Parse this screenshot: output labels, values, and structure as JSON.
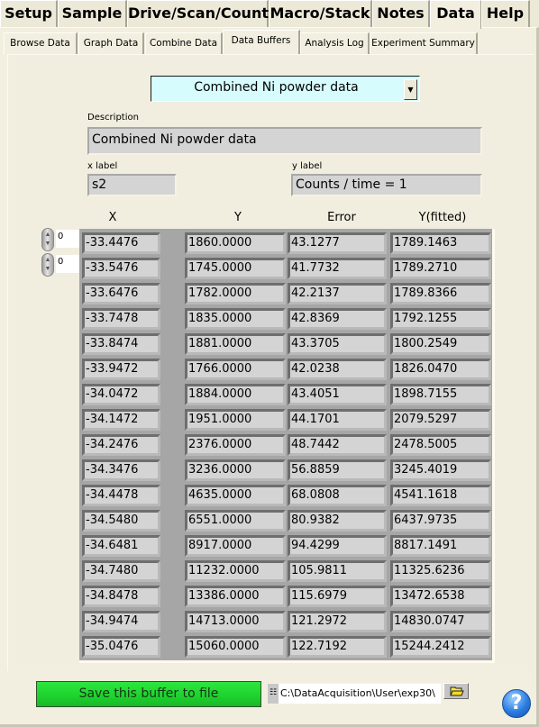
{
  "top_tabs": [
    {
      "label": "Setup",
      "active": false
    },
    {
      "label": "Sample",
      "active": false
    },
    {
      "label": "Drive/Scan/Count",
      "active": false
    },
    {
      "label": "Macro/Stack",
      "active": false
    },
    {
      "label": "Notes",
      "active": false
    },
    {
      "label": "Data",
      "active": true
    },
    {
      "label": "Help",
      "active": false
    }
  ],
  "sub_tabs": [
    {
      "label": "Browse Data",
      "active": false
    },
    {
      "label": "Graph Data",
      "active": false
    },
    {
      "label": "Combine Data",
      "active": false
    },
    {
      "label": "Data Buffers",
      "active": true
    },
    {
      "label": "Analysis Log",
      "active": false
    },
    {
      "label": "Experiment Summary",
      "active": false
    }
  ],
  "buffer_selector": {
    "value": "Combined Ni powder data",
    "arrow_icon": "dropdown-arrow"
  },
  "description": {
    "label": "Description",
    "value": "Combined Ni powder data"
  },
  "x_label": {
    "label": "x label",
    "value": "s2"
  },
  "y_label": {
    "label": "y label",
    "value": "Counts / time = 1"
  },
  "index_controls": {
    "row_index": "0",
    "col_index": "0"
  },
  "table": {
    "columns": [
      "X",
      "Y",
      "Error",
      "Y(fitted)"
    ],
    "rows": [
      [
        "-33.4476",
        "1860.0000",
        "43.1277",
        "1789.1463"
      ],
      [
        "-33.5476",
        "1745.0000",
        "41.7732",
        "1789.2710"
      ],
      [
        "-33.6476",
        "1782.0000",
        "42.2137",
        "1789.8366"
      ],
      [
        "-33.7478",
        "1835.0000",
        "42.8369",
        "1792.1255"
      ],
      [
        "-33.8474",
        "1881.0000",
        "43.3705",
        "1800.2549"
      ],
      [
        "-33.9472",
        "1766.0000",
        "42.0238",
        "1826.0470"
      ],
      [
        "-34.0472",
        "1884.0000",
        "43.4051",
        "1898.7155"
      ],
      [
        "-34.1472",
        "1951.0000",
        "44.1701",
        "2079.5297"
      ],
      [
        "-34.2476",
        "2376.0000",
        "48.7442",
        "2478.5005"
      ],
      [
        "-34.3476",
        "3236.0000",
        "56.8859",
        "3245.4019"
      ],
      [
        "-34.4478",
        "4635.0000",
        "68.0808",
        "4541.1618"
      ],
      [
        "-34.5480",
        "6551.0000",
        "80.9382",
        "6437.9735"
      ],
      [
        "-34.6481",
        "8917.0000",
        "94.4299",
        "8817.1491"
      ],
      [
        "-34.7480",
        "11232.0000",
        "105.9811",
        "11325.6236"
      ],
      [
        "-34.8478",
        "13386.0000",
        "115.6979",
        "13472.6538"
      ],
      [
        "-34.9474",
        "14713.0000",
        "121.2972",
        "14830.0747"
      ],
      [
        "-35.0476",
        "15060.0000",
        "122.7192",
        "15244.2412"
      ]
    ]
  },
  "footer": {
    "save_label": "Save this buffer to file",
    "save_color": "#22d932",
    "path_value": "C:\\DataAcquisition\\User\\exp30\\",
    "path_icon": "path-icon",
    "browse_icon": "folder-icon",
    "help_label": "?"
  }
}
